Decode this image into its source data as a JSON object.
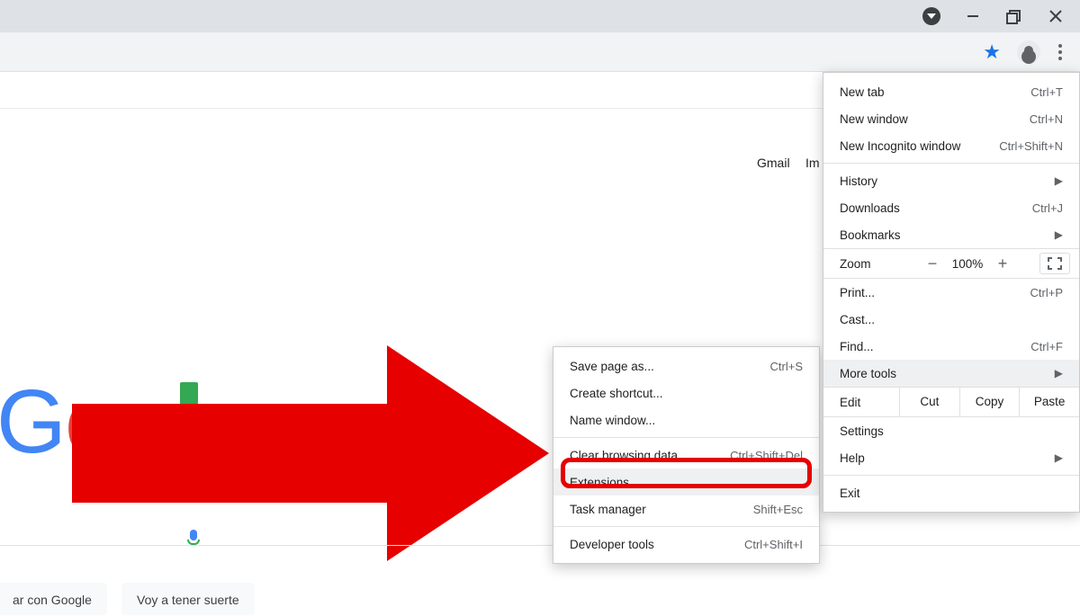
{
  "page": {
    "gmail": "Gmail",
    "images_partial": "Im",
    "button_search": "ar con Google",
    "button_lucky": "Voy a tener suerte"
  },
  "main_menu": {
    "new_tab": {
      "label": "New tab",
      "shortcut": "Ctrl+T"
    },
    "new_window": {
      "label": "New window",
      "shortcut": "Ctrl+N"
    },
    "incognito": {
      "label": "New Incognito window",
      "shortcut": "Ctrl+Shift+N"
    },
    "history": {
      "label": "History"
    },
    "downloads": {
      "label": "Downloads",
      "shortcut": "Ctrl+J"
    },
    "bookmarks": {
      "label": "Bookmarks"
    },
    "zoom": {
      "label": "Zoom",
      "value": "100%",
      "minus": "−",
      "plus": "+"
    },
    "print": {
      "label": "Print...",
      "shortcut": "Ctrl+P"
    },
    "cast": {
      "label": "Cast..."
    },
    "find": {
      "label": "Find...",
      "shortcut": "Ctrl+F"
    },
    "more_tools": {
      "label": "More tools"
    },
    "edit": {
      "label": "Edit",
      "cut": "Cut",
      "copy": "Copy",
      "paste": "Paste"
    },
    "settings": {
      "label": "Settings"
    },
    "help": {
      "label": "Help"
    },
    "exit": {
      "label": "Exit"
    }
  },
  "submenu": {
    "save_as": {
      "label": "Save page as...",
      "shortcut": "Ctrl+S"
    },
    "create_shortcut": {
      "label": "Create shortcut..."
    },
    "name_window": {
      "label": "Name window..."
    },
    "clear_data": {
      "label": "Clear browsing data...",
      "shortcut": "Ctrl+Shift+Del"
    },
    "extensions": {
      "label": "Extensions"
    },
    "task_manager": {
      "label": "Task manager",
      "shortcut": "Shift+Esc"
    },
    "dev_tools": {
      "label": "Developer tools",
      "shortcut": "Ctrl+Shift+I"
    }
  }
}
